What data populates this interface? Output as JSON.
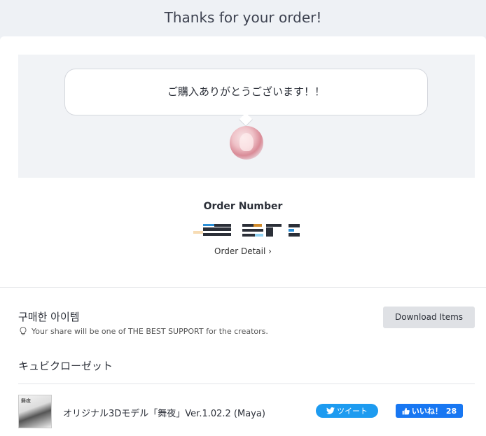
{
  "header": {
    "title": "Thanks for your order!"
  },
  "message": {
    "text": "ご購入ありがとうございます！！"
  },
  "order": {
    "label": "Order Number",
    "detail_link": "Order Detail ›"
  },
  "purchased": {
    "section_title": "구매한 아이템",
    "share_note": "Your share will be one of THE BEST SUPPORT for the creators.",
    "download_label": "Download Items"
  },
  "shop": {
    "name": "キュビクローゼット"
  },
  "item": {
    "title": "オリジナル3Dモデル「舞夜」Ver.1.02.2 (Maya)",
    "thumb_text": "舞夜",
    "tweet_label": "ツイート",
    "like_label": "いいね！",
    "like_count": "28"
  },
  "colors": {
    "twitter": "#1d9bf0",
    "facebook": "#1877f2",
    "download_bg": "#dfe1e5"
  }
}
